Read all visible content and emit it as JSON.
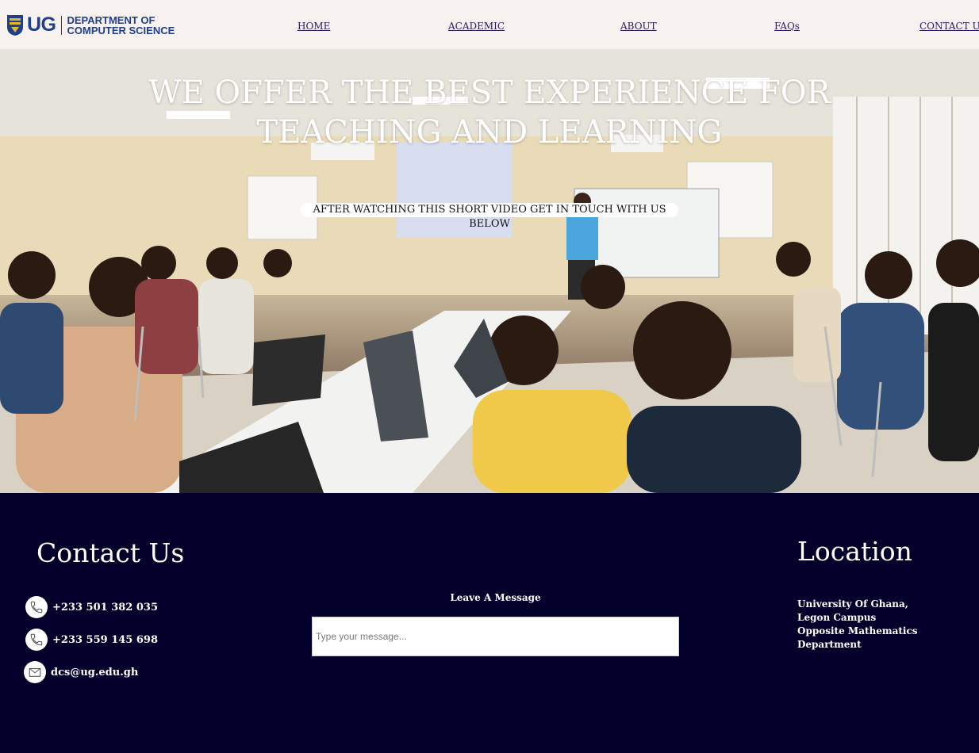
{
  "header": {
    "logo": {
      "mark": "UG",
      "line1": "DEPARTMENT OF",
      "line2": "COMPUTER SCIENCE",
      "brand_color": "#1f3f8a"
    },
    "nav": [
      {
        "label": "HOME"
      },
      {
        "label": "ACADEMIC"
      },
      {
        "label": "ABOUT"
      },
      {
        "label": "FAQs"
      },
      {
        "label": "CONTACT US"
      }
    ]
  },
  "hero": {
    "title_line1": "WE OFFER THE BEST EXPERIENCE FOR",
    "title_line2": "TEACHING AND LEARNING",
    "subtitle": "AFTER WATCHING THIS SHORT VIDEO GET IN TOUCH WITH US BELOW"
  },
  "footer": {
    "background": "#02002a",
    "contact": {
      "heading": "Contact Us",
      "items": [
        {
          "icon": "phone-icon",
          "text": "+233 501 382 035"
        },
        {
          "icon": "phone-icon",
          "text": "+233 559 145 698"
        },
        {
          "icon": "mail-icon",
          "text": "dcs@ug.edu.gh"
        }
      ]
    },
    "message": {
      "label": "Leave A Message",
      "placeholder": "Type your message...",
      "value": ""
    },
    "location": {
      "heading": "Location",
      "line1": "University Of Ghana,",
      "line2": "Legon Campus",
      "line3": "Opposite Mathematics Department"
    }
  }
}
